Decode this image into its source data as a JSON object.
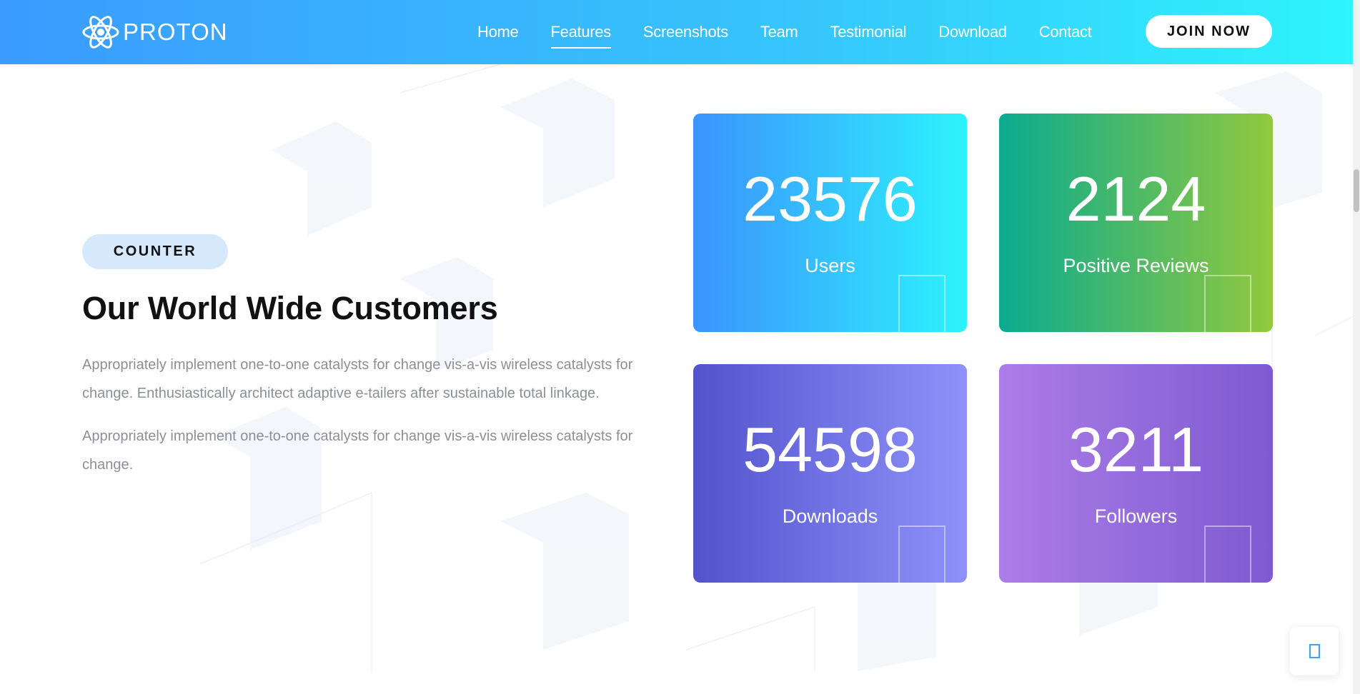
{
  "header": {
    "logo_text": "PROTON",
    "nav": [
      {
        "label": "Home"
      },
      {
        "label": "Features"
      },
      {
        "label": "Screenshots"
      },
      {
        "label": "Team"
      },
      {
        "label": "Testimonial"
      },
      {
        "label": "Download"
      },
      {
        "label": "Contact"
      }
    ],
    "active_nav": "Features",
    "join_label": "JOIN NOW"
  },
  "counter_section": {
    "badge": "COUNTER",
    "title": "Our World Wide Customers",
    "paragraphs": [
      "Appropriately implement one-to-one catalysts for change vis-a-vis wireless catalysts for change. Enthusiastically architect adaptive e-tailers after sustainable total linkage.",
      "Appropriately implement one-to-one catalysts for change vis-a-vis wireless catalysts for change."
    ],
    "cards": [
      {
        "number": "23576",
        "label": "Users"
      },
      {
        "number": "2124",
        "label": "Positive Reviews"
      },
      {
        "number": "54598",
        "label": "Downloads"
      },
      {
        "number": "3211",
        "label": "Followers"
      }
    ]
  },
  "colors": {
    "header_gradient_start": "#3b9bff",
    "header_gradient_end": "#2ef4fc",
    "badge_bg": "#d6e9fc",
    "body_text": "#8c8f96",
    "card_users": [
      "#3b93fd",
      "#2df3fd"
    ],
    "card_reviews": [
      "#0aab8f",
      "#92c83e"
    ],
    "card_downloads": [
      "#5354cd",
      "#8f91fa"
    ],
    "card_followers": [
      "#ad7ce8",
      "#7d5bd0"
    ]
  },
  "icons": {
    "logo": "atom-icon",
    "back_to_top": "arrow-up-icon"
  }
}
